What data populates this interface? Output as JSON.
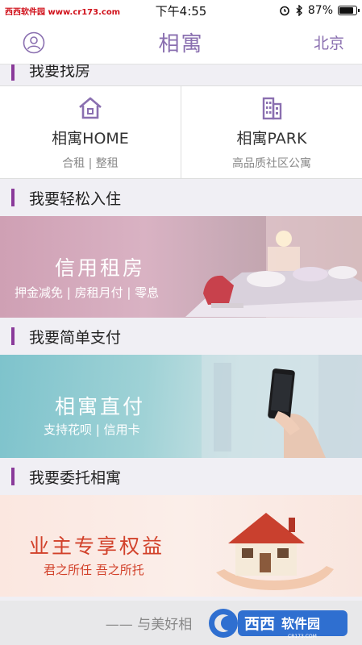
{
  "status_bar": {
    "watermark": "西西软件园 www.cr173.com",
    "time": "下午4:55",
    "battery": "87%",
    "battery_level": 0.87
  },
  "nav": {
    "title": "相寓",
    "city": "北京"
  },
  "sections": {
    "find_home": "我要找房",
    "easy_checkin": "我要轻松入住",
    "simple_pay": "我要简单支付",
    "entrust": "我要委托相寓"
  },
  "cards": [
    {
      "title": "相寓HOME",
      "subtitle": "合租 | 整租",
      "icon": "house-icon"
    },
    {
      "title": "相寓PARK",
      "subtitle": "高品质社区公寓",
      "icon": "building-icon"
    }
  ],
  "banners": {
    "rent": {
      "title": "信用租房",
      "subtitle": "押金减免 | 房租月付 | 零息"
    },
    "pay": {
      "title": "相寓直付",
      "subtitle": "支持花呗 | 信用卡"
    },
    "owner": {
      "title": "业主专享权益",
      "subtitle": "君之所任 吾之所托"
    }
  },
  "footer": {
    "text": "—— 与美好相",
    "logo_text": "西西软件园",
    "logo_sub": "CR173.COM"
  },
  "colors": {
    "accent": "#8a6fb0",
    "section_bar": "#8a3a9a",
    "owner_red": "#d2412a"
  }
}
